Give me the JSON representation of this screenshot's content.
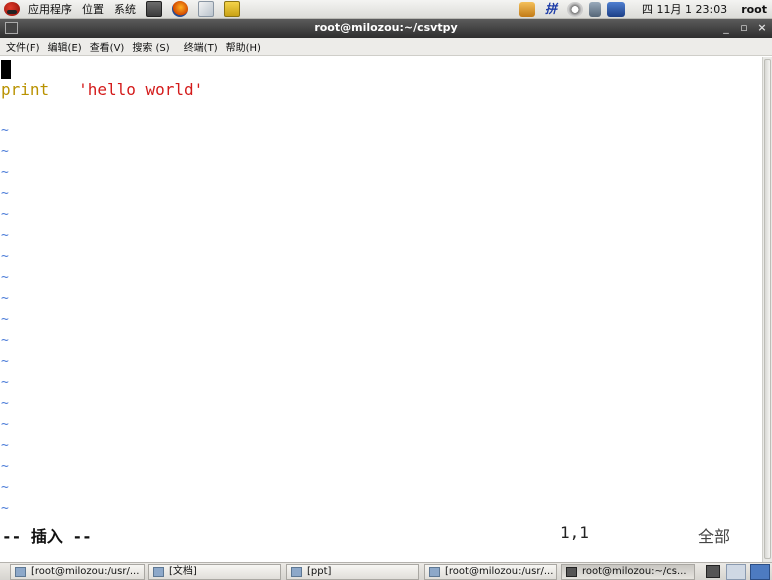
{
  "top_panel": {
    "menus": [
      "应用程序",
      "位置",
      "系统"
    ],
    "launchers": [
      "terminal-icon",
      "firefox-icon",
      "mail-icon",
      "notes-icon"
    ],
    "tray_icons": [
      "network-icon",
      "input-method-icon",
      "update-icon",
      "volume-icon",
      "display-icon"
    ],
    "input_method_label": "拼",
    "clock": "四 11月  1 23:03",
    "user": "root"
  },
  "window": {
    "title": "root@milozou:~/csvtpy",
    "minimize": "_",
    "maximize": "▫",
    "close": "×"
  },
  "menubar": {
    "items": [
      "文件(F)",
      "编辑(E)",
      "查看(V)",
      "搜索 (S)",
      "终端(T)",
      "帮助(H)"
    ]
  },
  "editor": {
    "keyword": "print",
    "string": "'hello world'",
    "tilde": "~",
    "mode": "-- 插入 --",
    "position": "1,1",
    "scroll": "全部"
  },
  "taskbar": {
    "tasks": [
      "[root@milozou:/usr/...",
      "[文档]",
      "[ppt]",
      "[root@milozou:/usr/...",
      "root@milozou:~/cs..."
    ]
  },
  "colors": {
    "keyword": "#b99200",
    "string": "#d41b1b",
    "tilde": "#4a7bd8"
  }
}
